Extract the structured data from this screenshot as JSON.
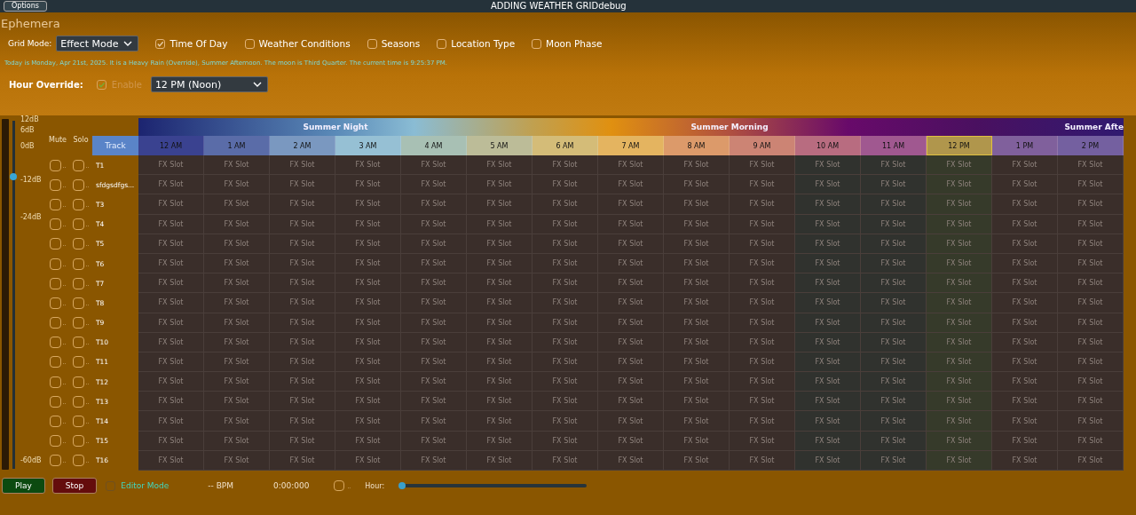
{
  "title_bar": {
    "options_button": "Options",
    "title": "ADDING WEATHER GRIDdebug"
  },
  "app_title": "Ephemera",
  "grid_mode": {
    "label": "Grid Mode:",
    "value": "Effect Mode"
  },
  "filters": [
    {
      "label": "Time Of Day",
      "checked": true
    },
    {
      "label": "Weather Conditions",
      "checked": false
    },
    {
      "label": "Seasons",
      "checked": false
    },
    {
      "label": "Location Type",
      "checked": false
    },
    {
      "label": "Moon Phase",
      "checked": false
    }
  ],
  "status_text": "Today is Monday, Apr 21st, 2025. It is a Heavy Rain (Override), Summer Afternoon. The moon is Third Quarter. The current time is 9:25:37 PM.",
  "hour_override": {
    "label": "Hour Override:",
    "enable_label": "Enable",
    "enabled": true,
    "value": "12 PM (Noon)"
  },
  "master_volume": {
    "level": 0.84,
    "scale": [
      "12dB",
      "6dB",
      "0dB",
      "-12dB",
      "-24dB",
      "-60dB"
    ]
  },
  "grid": {
    "mute_header": "Mute",
    "solo_header": "Solo",
    "track_header": "Track",
    "seasons": [
      {
        "label": "Summer Night"
      },
      {
        "label": "Summer Morning"
      },
      {
        "label": "Summer Afte"
      }
    ],
    "hours": [
      {
        "label": "12 AM",
        "color": "#3a4290",
        "selected": false
      },
      {
        "label": "1 AM",
        "color": "#5a6ca8",
        "selected": false
      },
      {
        "label": "2 AM",
        "color": "#7a98c0",
        "selected": false
      },
      {
        "label": "3 AM",
        "color": "#96c0d4",
        "selected": false
      },
      {
        "label": "4 AM",
        "color": "#a8c0b4",
        "selected": false
      },
      {
        "label": "5 AM",
        "color": "#bcbc98",
        "selected": false
      },
      {
        "label": "6 AM",
        "color": "#d4bc78",
        "selected": false
      },
      {
        "label": "7 AM",
        "color": "#e4b460",
        "selected": false
      },
      {
        "label": "8 AM",
        "color": "#dc9a6a",
        "selected": false
      },
      {
        "label": "9 AM",
        "color": "#cc8474",
        "selected": false
      },
      {
        "label": "10 AM",
        "color": "#b86c80",
        "selected": false
      },
      {
        "label": "11 AM",
        "color": "#a05890",
        "selected": false
      },
      {
        "label": "12 PM",
        "color": "#b0964c",
        "selected": true
      },
      {
        "label": "1 PM",
        "color": "#80609c",
        "selected": false
      },
      {
        "label": "2 PM",
        "color": "#7460a0",
        "selected": false
      }
    ],
    "rows": [
      {
        "track": "T1",
        "mute": false,
        "mute_label": "..",
        "solo": false,
        "solo_label": "..",
        "slots": [
          "FX Slot",
          "FX Slot",
          "FX Slot",
          "FX Slot",
          "FX Slot",
          "FX Slot",
          "FX Slot",
          "FX Slot",
          "FX Slot",
          "FX Slot",
          "FX Slot",
          "FX Slot",
          "FX Slot",
          "FX Slot",
          "FX Slot"
        ]
      },
      {
        "track": "sfdgsdfgs...",
        "mute": false,
        "mute_label": "..",
        "solo": false,
        "solo_label": "..",
        "slots": [
          "FX Slot",
          "FX Slot",
          "FX Slot",
          "FX Slot",
          "FX Slot",
          "FX Slot",
          "FX Slot",
          "FX Slot",
          "FX Slot",
          "FX Slot",
          "FX Slot",
          "FX Slot",
          "FX Slot",
          "FX Slot",
          "FX Slot"
        ]
      },
      {
        "track": "T3",
        "mute": false,
        "mute_label": "..",
        "solo": false,
        "solo_label": "..",
        "slots": [
          "FX Slot",
          "FX Slot",
          "FX Slot",
          "FX Slot",
          "FX Slot",
          "FX Slot",
          "FX Slot",
          "FX Slot",
          "FX Slot",
          "FX Slot",
          "FX Slot",
          "FX Slot",
          "FX Slot",
          "FX Slot",
          "FX Slot"
        ]
      },
      {
        "track": "T4",
        "mute": false,
        "mute_label": "..",
        "solo": false,
        "solo_label": "..",
        "slots": [
          "FX Slot",
          "FX Slot",
          "FX Slot",
          "FX Slot",
          "FX Slot",
          "FX Slot",
          "FX Slot",
          "FX Slot",
          "FX Slot",
          "FX Slot",
          "FX Slot",
          "FX Slot",
          "FX Slot",
          "FX Slot",
          "FX Slot"
        ]
      },
      {
        "track": "T5",
        "mute": false,
        "mute_label": "..",
        "solo": false,
        "solo_label": "..",
        "slots": [
          "FX Slot",
          "FX Slot",
          "FX Slot",
          "FX Slot",
          "FX Slot",
          "FX Slot",
          "FX Slot",
          "FX Slot",
          "FX Slot",
          "FX Slot",
          "FX Slot",
          "FX Slot",
          "FX Slot",
          "FX Slot",
          "FX Slot"
        ]
      },
      {
        "track": "T6",
        "mute": false,
        "mute_label": "..",
        "solo": false,
        "solo_label": "..",
        "slots": [
          "FX Slot",
          "FX Slot",
          "FX Slot",
          "FX Slot",
          "FX Slot",
          "FX Slot",
          "FX Slot",
          "FX Slot",
          "FX Slot",
          "FX Slot",
          "FX Slot",
          "FX Slot",
          "FX Slot",
          "FX Slot",
          "FX Slot"
        ]
      },
      {
        "track": "T7",
        "mute": false,
        "mute_label": "..",
        "solo": false,
        "solo_label": "..",
        "slots": [
          "FX Slot",
          "FX Slot",
          "FX Slot",
          "FX Slot",
          "FX Slot",
          "FX Slot",
          "FX Slot",
          "FX Slot",
          "FX Slot",
          "FX Slot",
          "FX Slot",
          "FX Slot",
          "FX Slot",
          "FX Slot",
          "FX Slot"
        ]
      },
      {
        "track": "T8",
        "mute": false,
        "mute_label": "..",
        "solo": false,
        "solo_label": "..",
        "slots": [
          "FX Slot",
          "FX Slot",
          "FX Slot",
          "FX Slot",
          "FX Slot",
          "FX Slot",
          "FX Slot",
          "FX Slot",
          "FX Slot",
          "FX Slot",
          "FX Slot",
          "FX Slot",
          "FX Slot",
          "FX Slot",
          "FX Slot"
        ]
      },
      {
        "track": "T9",
        "mute": false,
        "mute_label": "..",
        "solo": false,
        "solo_label": "..",
        "slots": [
          "FX Slot",
          "FX Slot",
          "FX Slot",
          "FX Slot",
          "FX Slot",
          "FX Slot",
          "FX Slot",
          "FX Slot",
          "FX Slot",
          "FX Slot",
          "FX Slot",
          "FX Slot",
          "FX Slot",
          "FX Slot",
          "FX Slot"
        ]
      },
      {
        "track": "T10",
        "mute": false,
        "mute_label": "..",
        "solo": false,
        "solo_label": "..",
        "slots": [
          "FX Slot",
          "FX Slot",
          "FX Slot",
          "FX Slot",
          "FX Slot",
          "FX Slot",
          "FX Slot",
          "FX Slot",
          "FX Slot",
          "FX Slot",
          "FX Slot",
          "FX Slot",
          "FX Slot",
          "FX Slot",
          "FX Slot"
        ]
      },
      {
        "track": "T11",
        "mute": false,
        "mute_label": "..",
        "solo": false,
        "solo_label": "..",
        "slots": [
          "FX Slot",
          "FX Slot",
          "FX Slot",
          "FX Slot",
          "FX Slot",
          "FX Slot",
          "FX Slot",
          "FX Slot",
          "FX Slot",
          "FX Slot",
          "FX Slot",
          "FX Slot",
          "FX Slot",
          "FX Slot",
          "FX Slot"
        ]
      },
      {
        "track": "T12",
        "mute": false,
        "mute_label": "..",
        "solo": false,
        "solo_label": "..",
        "slots": [
          "FX Slot",
          "FX Slot",
          "FX Slot",
          "FX Slot",
          "FX Slot",
          "FX Slot",
          "FX Slot",
          "FX Slot",
          "FX Slot",
          "FX Slot",
          "FX Slot",
          "FX Slot",
          "FX Slot",
          "FX Slot",
          "FX Slot"
        ]
      },
      {
        "track": "T13",
        "mute": false,
        "mute_label": "..",
        "solo": false,
        "solo_label": "..",
        "slots": [
          "FX Slot",
          "FX Slot",
          "FX Slot",
          "FX Slot",
          "FX Slot",
          "FX Slot",
          "FX Slot",
          "FX Slot",
          "FX Slot",
          "FX Slot",
          "FX Slot",
          "FX Slot",
          "FX Slot",
          "FX Slot",
          "FX Slot"
        ]
      },
      {
        "track": "T14",
        "mute": false,
        "mute_label": "..",
        "solo": false,
        "solo_label": "..",
        "slots": [
          "FX Slot",
          "FX Slot",
          "FX Slot",
          "FX Slot",
          "FX Slot",
          "FX Slot",
          "FX Slot",
          "FX Slot",
          "FX Slot",
          "FX Slot",
          "FX Slot",
          "FX Slot",
          "FX Slot",
          "FX Slot",
          "FX Slot"
        ]
      },
      {
        "track": "T15",
        "mute": false,
        "mute_label": "..",
        "solo": false,
        "solo_label": "..",
        "slots": [
          "FX Slot",
          "FX Slot",
          "FX Slot",
          "FX Slot",
          "FX Slot",
          "FX Slot",
          "FX Slot",
          "FX Slot",
          "FX Slot",
          "FX Slot",
          "FX Slot",
          "FX Slot",
          "FX Slot",
          "FX Slot",
          "FX Slot"
        ]
      },
      {
        "track": "T16",
        "mute": false,
        "mute_label": "..",
        "solo": false,
        "solo_label": "..",
        "slots": [
          "FX Slot",
          "FX Slot",
          "FX Slot",
          "FX Slot",
          "FX Slot",
          "FX Slot",
          "FX Slot",
          "FX Slot",
          "FX Slot",
          "FX Slot",
          "FX Slot",
          "FX Slot",
          "FX Slot",
          "FX Slot",
          "FX Slot"
        ]
      }
    ]
  },
  "transport": {
    "play": "Play",
    "stop": "Stop",
    "editor_mode": {
      "label": "Editor Mode",
      "checked": false
    },
    "bpm": "-- BPM",
    "time": "0:00:000",
    "toggle": {
      "label": "..",
      "checked": false
    },
    "hour_label": "Hour:",
    "hour_slider": {
      "level": 0
    }
  }
}
